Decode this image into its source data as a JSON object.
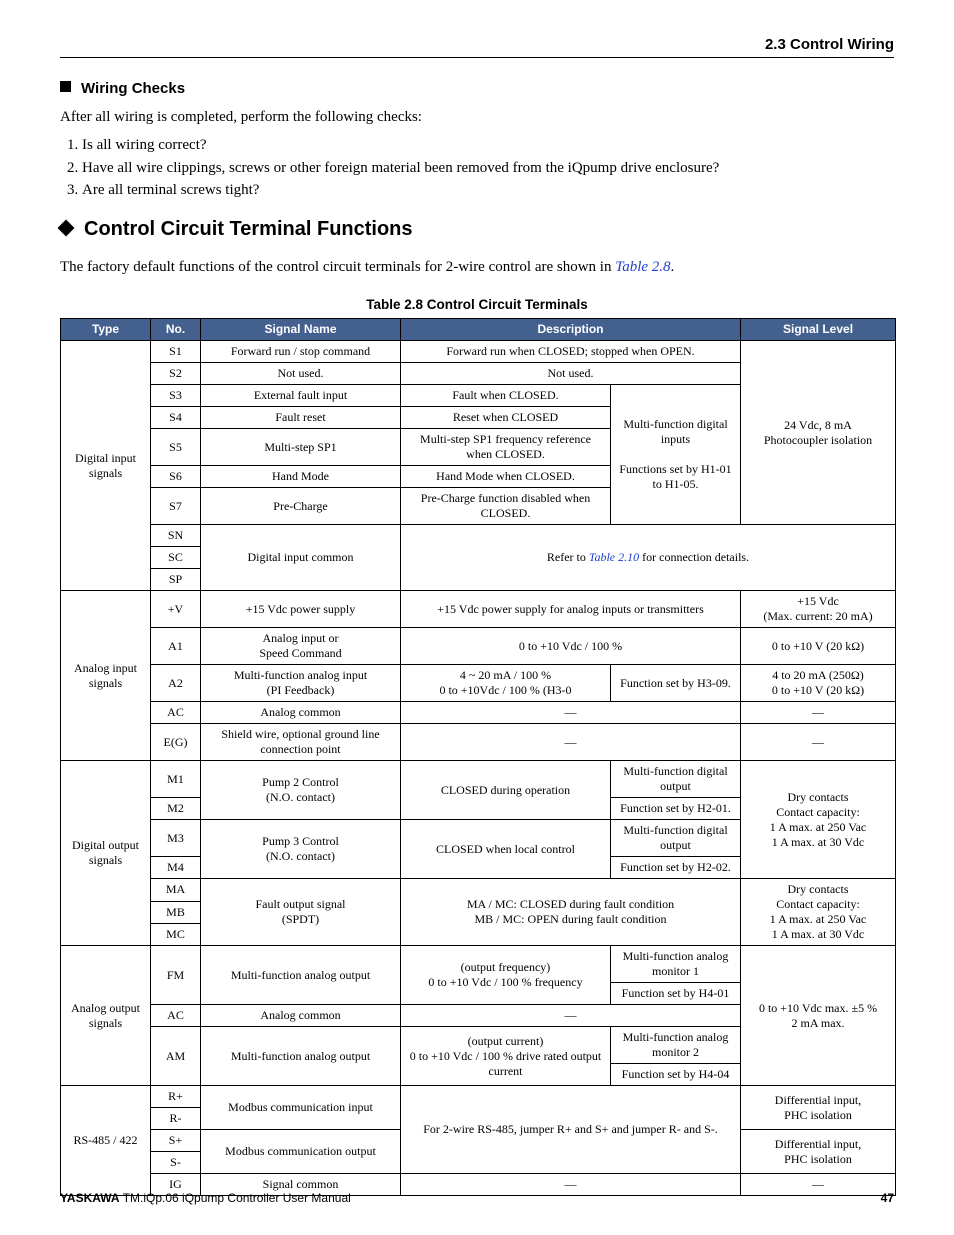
{
  "header": {
    "section": "2.3 Control Wiring"
  },
  "wiring": {
    "icon": "square",
    "title": "Wiring Checks",
    "intro": "After all wiring is completed, perform the following checks:",
    "items": [
      "Is all wiring correct?",
      "Have all wire clippings, screws or other foreign material been removed from the iQpump drive enclosure?",
      "Are all terminal screws tight?"
    ]
  },
  "ccf": {
    "icon": "diamond",
    "title": "Control Circuit Terminal Functions",
    "body_pre": "The factory default functions of the control circuit terminals for 2-wire control are shown in ",
    "link": "Table 2.8",
    "body_post": "."
  },
  "table": {
    "title": "Table 2.8  Control Circuit Terminals",
    "headers": {
      "type": "Type",
      "no": "No.",
      "name": "Signal Name",
      "desc": "Description",
      "level": "Signal Level"
    },
    "groups": [
      {
        "type": "Digital input signals",
        "level": "24 Vdc, 8 mA\nPhotocoupler isolation",
        "rows": [
          {
            "no": "S1",
            "name": "Forward run / stop command",
            "d1": "Forward run when CLOSED; stopped when OPEN.",
            "d2": null,
            "d1span": 2
          },
          {
            "no": "S2",
            "name": "Not used.",
            "d1": "Not used.",
            "d2": null,
            "d1span": 2
          },
          {
            "no": "S3",
            "name": "External fault input",
            "d1": "Fault when CLOSED.",
            "d2": "Multi-function digital inputs\n\nFunctions set by H1-01 to H1-05.",
            "d2rows": 5
          },
          {
            "no": "S4",
            "name": "Fault reset",
            "d1": "Reset when CLOSED"
          },
          {
            "no": "S5",
            "name": "Multi-step SP1",
            "d1": "Multi-step SP1 frequency reference when CLOSED."
          },
          {
            "no": "S6",
            "name": "Hand Mode",
            "d1": "Hand Mode when CLOSED."
          },
          {
            "no": "S7",
            "name": "Pre-Charge",
            "d1": "Pre-Charge function disabled when CLOSED."
          }
        ],
        "common": {
          "nos": [
            "SN",
            "SC",
            "SP"
          ],
          "name": "Digital input common",
          "desc_pre": "Refer to ",
          "desc_link": "Table 2.10",
          "desc_post": " for connection details."
        }
      },
      {
        "type": "Analog input signals",
        "rows": [
          {
            "no": "+V",
            "name": "+15 Vdc power supply",
            "d1": "+15 Vdc power supply for analog inputs or transmitters",
            "d1span": 2,
            "level": "+15 Vdc\n(Max. current: 20 mA)"
          },
          {
            "no": "A1",
            "name": "Analog input or\nSpeed Command",
            "d1": "0 to +10 Vdc / 100 %",
            "d1span": 2,
            "level": "0 to +10 V (20 kΩ)"
          },
          {
            "no": "A2",
            "name": "Multi-function analog input\n(PI Feedback)",
            "d1": "4 ~ 20 mA / 100 %\n0 to +10Vdc / 100 % (H3-0",
            "d2": "Function set by H3-09.",
            "level": "4 to 20 mA (250Ω)\n0 to +10 V (20 kΩ)"
          },
          {
            "no": "AC",
            "name": "Analog common",
            "d1": "—",
            "d1span": 2,
            "level": "—"
          },
          {
            "no": "E(G)",
            "name": "Shield wire, optional ground line connection point",
            "d1": "—",
            "d1span": 2,
            "level": "—"
          }
        ]
      },
      {
        "type": "Digital output signals",
        "blocks": [
          {
            "nos": [
              "M1",
              "M2"
            ],
            "name": "Pump 2 Control\n(N.O. contact)",
            "d1": "CLOSED during operation",
            "d2": [
              "Multi-function digital output",
              "Function set by H2-01."
            ],
            "level": "Dry contacts\nContact capacity:\n1 A max. at 250 Vac\n1 A max. at 30 Vdc",
            "levelRows": 4
          },
          {
            "nos": [
              "M3",
              "M4"
            ],
            "name": "Pump 3 Control\n(N.O. contact)",
            "d1": "CLOSED when local control",
            "d2": [
              "Multi-function digital output",
              "Function set by H2-02."
            ]
          },
          {
            "nos": [
              "MA",
              "MB",
              "MC"
            ],
            "name": "Fault output signal\n(SPDT)",
            "d1": "MA / MC: CLOSED during fault condition\nMB / MC: OPEN during fault condition",
            "d1span": 2,
            "level": "Dry contacts\nContact capacity:\n1 A max. at 250 Vac\n1 A max. at 30 Vdc"
          }
        ]
      },
      {
        "type": "Analog output signals",
        "level": "0 to +10 Vdc max. ±5 %\n2 mA max.",
        "rows": [
          {
            "no": "FM",
            "name": "Multi-function analog output",
            "d1": "(output frequency)\n0 to +10 Vdc / 100 % frequency",
            "d2": [
              "Multi-function analog monitor 1",
              "Function set by H4-01"
            ]
          },
          {
            "no": "AC",
            "name": "Analog common",
            "d1": "—",
            "d1span": 2
          },
          {
            "no": "AM",
            "name": "Multi-function analog output",
            "d1": "(output current)\n0 to +10 Vdc / 100 % drive rated output current",
            "d2": [
              "Multi-function analog monitor 2",
              "Function set by H4-04"
            ]
          }
        ]
      },
      {
        "type": "RS-485 / 422",
        "blocks": [
          {
            "nos": [
              "R+",
              "R-"
            ],
            "name": "Modbus communication input",
            "d1": "For 2-wire RS-485, jumper R+ and S+ and jumper R- and S-.",
            "d1rows": 4,
            "d1span": 2,
            "level": "Differential input,\nPHC isolation"
          },
          {
            "nos": [
              "S+",
              "S-"
            ],
            "name": "Modbus communication output",
            "level": "Differential input,\nPHC isolation"
          },
          {
            "nos": [
              "IG"
            ],
            "name": "Signal common",
            "d1": "—",
            "d1span": 2,
            "level": "—"
          }
        ]
      }
    ]
  },
  "footer": {
    "brand": "YASKAWA",
    "manual": "TM.iQp.06 iQpump Controller User Manual",
    "page": "47"
  }
}
